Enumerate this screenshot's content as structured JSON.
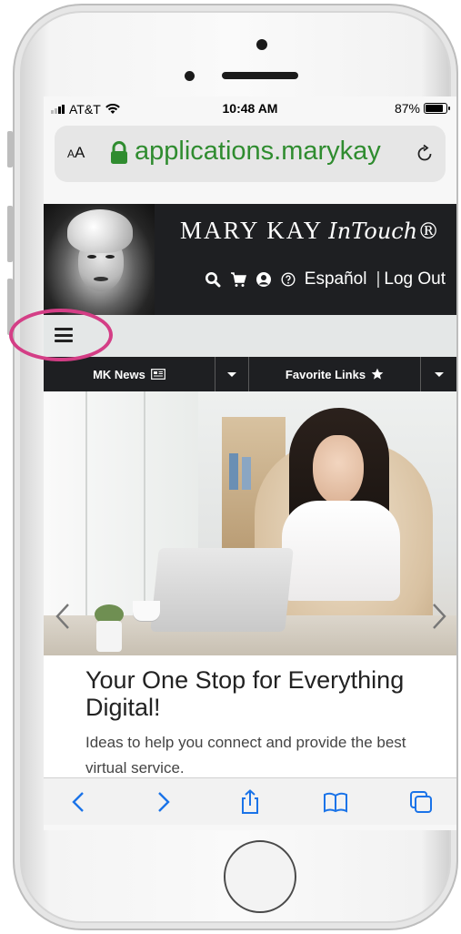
{
  "status_bar": {
    "carrier": "AT&T",
    "time": "10:48 AM",
    "battery_percent": "87%",
    "battery_level": 0.87
  },
  "browser": {
    "text_size_label": "AA",
    "url": "applications.marykay",
    "lock_icon": "lock-icon",
    "reload_icon": "reload-icon"
  },
  "header": {
    "brand": "MARY KAY",
    "brand_script": "InTouch®",
    "language_link": "Español",
    "separator": "|",
    "logout_link": "Log Out",
    "icons": [
      "search-icon",
      "cart-icon",
      "account-icon",
      "help-icon"
    ]
  },
  "nav": {
    "menu_icon": "hamburger-icon"
  },
  "quick_bar": {
    "news_label": "MK News",
    "favorites_label": "Favorite Links"
  },
  "promo": {
    "title": "Your One Stop for Everything Digital!",
    "text": "Ideas to help you connect and provide the best virtual service."
  },
  "toolbar": {
    "icons": [
      "back-icon",
      "forward-icon",
      "share-icon",
      "bookmarks-icon",
      "tabs-icon"
    ]
  },
  "colors": {
    "url_green": "#2f8c2f",
    "header_bg": "#1e1f22",
    "nav_strip": "#e4e7e7",
    "ios_blue": "#1a73e8",
    "highlight": "#d43e86"
  }
}
